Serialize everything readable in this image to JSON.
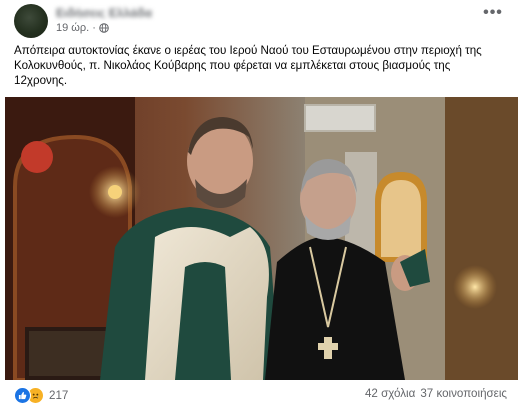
{
  "post": {
    "author": "Ειδήσεις Ελλάδα",
    "time": "19 ώρ.",
    "separator": "·",
    "privacy_icon": "globe-icon",
    "more_icon": "more-options-icon",
    "text_lines": [
      "Απόπειρα αυτοκτονίας έκανε ο ιερέας του Ιερού Ναού του Εσταυρωμένου στην περιοχή της",
      "Κολοκυνθούς, π. Νικολάος Κούβαρης  που φέρεται να εμπλέκεται στους βιασμούς της",
      "12χρονης."
    ]
  },
  "footer": {
    "reaction_icons": [
      "like-icon",
      "sad-icon"
    ],
    "reaction_count": "217",
    "comments": "42 σχόλια",
    "shares": "37 κοινοποιήσεις"
  },
  "colors": {
    "like_blue": "#1b74e4",
    "sad_yellow": "#f7b125",
    "secondary_text": "#65676b"
  }
}
